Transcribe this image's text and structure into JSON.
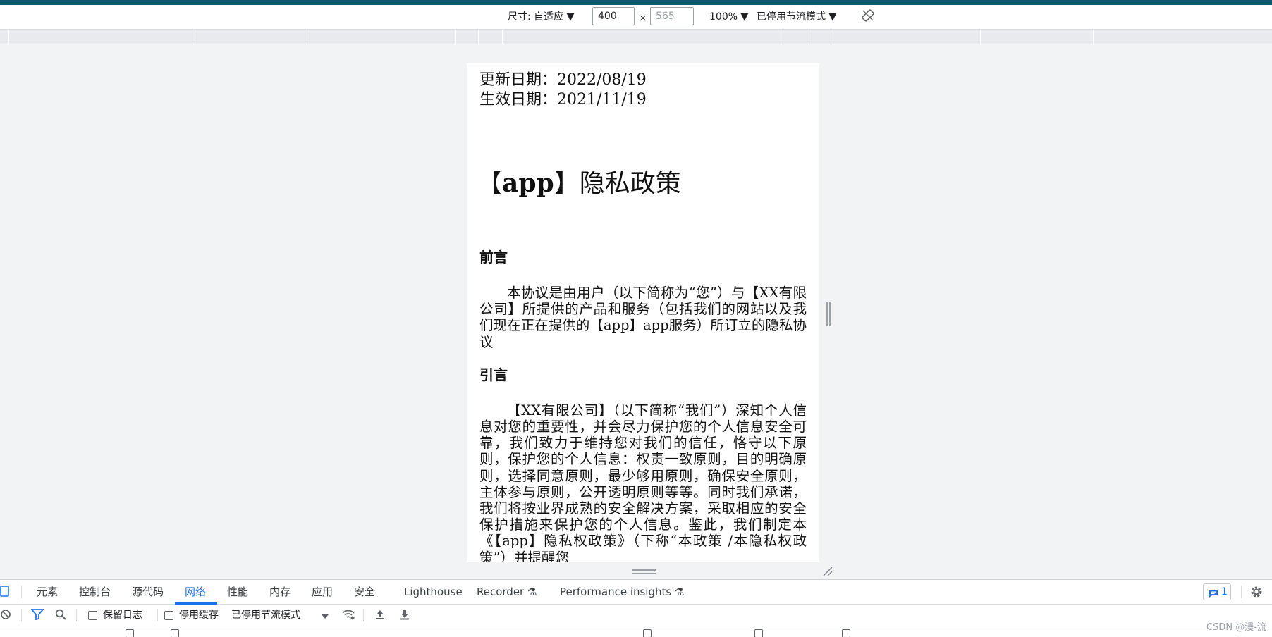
{
  "device_toolbar": {
    "dimensions_label": "尺寸: 自适应 ▼",
    "width_value": "400",
    "times": "×",
    "height_value": "565",
    "zoom": "100% ▼",
    "throttling": "已停用节流模式 ▼"
  },
  "page": {
    "updated_date": "更新日期：2022/08/19",
    "effective_date": "生效日期：2021/11/19",
    "title_bracket_open": "【",
    "title_app": "app",
    "title_rest": "】隐私政策",
    "section_preface": "前言",
    "preface_text": "本协议是由用户（以下简称为“您”）与【XX有限公司】所提供的产品和服务（包括我们的网站以及我们现在正在提供的【app】app服务）所订立的隐私协议",
    "section_intro": "引言",
    "intro_text": "【XX有限公司】（以下简称“我们”）深知个人信息对您的重要性，并会尽力保护您的个人信息安全可靠，我们致力于维持您对我们的信任，恪守以下原则，保护您的个人信息：权责一致原则，目的明确原则，选择同意原则，最少够用原则，确保安全原则，主体参与原则，公开透明原则等等。同时我们承诺，我们将按业界成熟的安全解决方案，采取相应的安全保护措施来保护您的个人信息。鉴此，我们制定本《【app】隐私权政策》（下称“本政策 /本隐私权政策”）并提醒您"
  },
  "devtools": {
    "tabs": [
      {
        "label": "元素"
      },
      {
        "label": "控制台"
      },
      {
        "label": "源代码"
      },
      {
        "label": "网络"
      },
      {
        "label": "性能"
      },
      {
        "label": "内存"
      },
      {
        "label": "应用"
      },
      {
        "label": "安全"
      },
      {
        "label": "Lighthouse"
      },
      {
        "label": "Recorder"
      },
      {
        "label": "Performance insights"
      }
    ],
    "issues_count": "1",
    "network_toolbar": {
      "preserve_log": "保留日志",
      "disable_cache": "停用缓存",
      "throttling": "已停用节流模式"
    }
  },
  "watermark": "CSDN @漫-流"
}
